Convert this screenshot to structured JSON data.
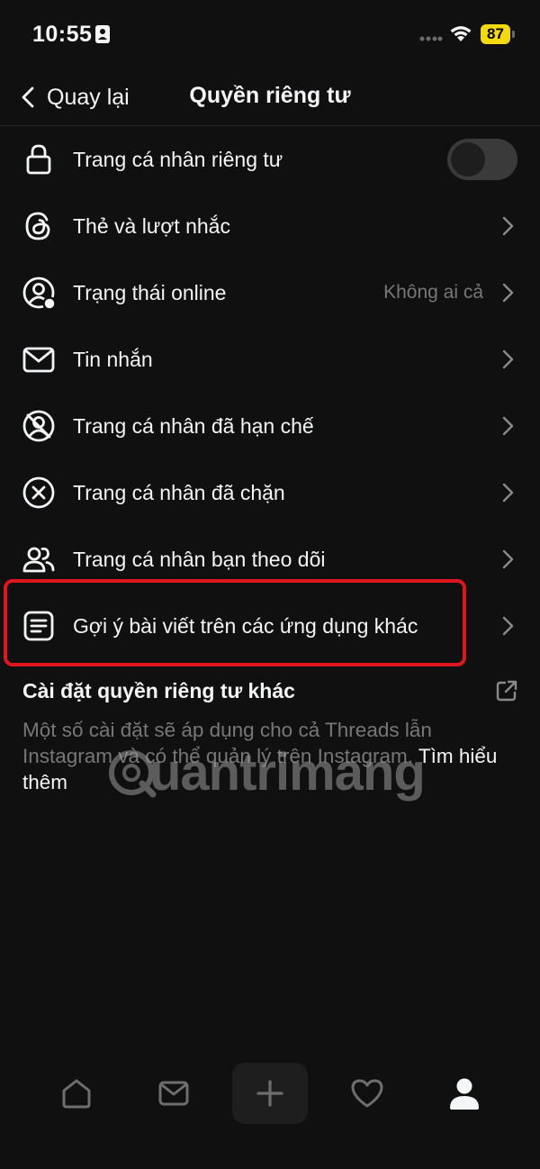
{
  "status_bar": {
    "time": "10:55",
    "battery": "87",
    "battery_color": "#f5d90a"
  },
  "header": {
    "back_label": "Quay lại",
    "title": "Quyền riêng tư"
  },
  "settings": [
    {
      "label": "Trang cá nhân riêng tư",
      "icon": "lock-icon",
      "control": "toggle",
      "toggle_on": false
    },
    {
      "label": "Thẻ và lượt nhắc",
      "icon": "threads-icon",
      "control": "chevron"
    },
    {
      "label": "Trạng thái online",
      "icon": "online-status-icon",
      "control": "chevron",
      "value": "Không ai cả"
    },
    {
      "label": "Tin nhắn",
      "icon": "mail-icon",
      "control": "chevron"
    },
    {
      "label": "Trang cá nhân đã hạn chế",
      "icon": "restricted-profile-icon",
      "control": "chevron"
    },
    {
      "label": "Trang cá nhân đã chặn",
      "icon": "blocked-icon",
      "control": "chevron"
    },
    {
      "label": "Trang cá nhân bạn theo dõi",
      "icon": "following-icon",
      "control": "chevron"
    },
    {
      "label": "Gợi ý bài viết trên các ứng dụng khác",
      "icon": "post-suggestion-icon",
      "control": "chevron",
      "highlighted": true
    }
  ],
  "other_settings": {
    "title": "Cài đặt quyền riêng tư khác",
    "description": "Một số cài đặt sẽ áp dụng cho cả Threads lẫn Instagram và có thể quản lý trên Instagram.",
    "learn_more": "Tìm hiểu thêm"
  },
  "watermark": "uantrimang",
  "bottom_nav": [
    {
      "icon": "home-icon"
    },
    {
      "icon": "inbox-icon"
    },
    {
      "icon": "create-plus-icon"
    },
    {
      "icon": "activity-heart-icon"
    },
    {
      "icon": "profile-icon",
      "active": true
    }
  ],
  "colors": {
    "background": "#101010",
    "text": "#f3f5f7",
    "secondary_text": "#777777",
    "highlight_border": "#e0161e"
  }
}
